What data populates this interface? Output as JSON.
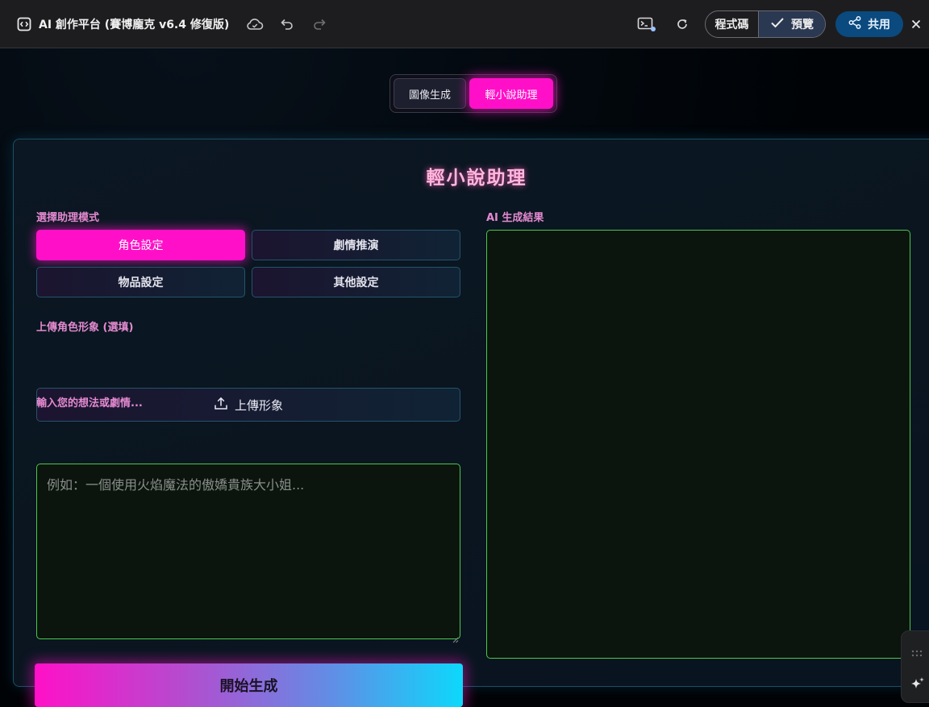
{
  "topbar": {
    "title": "AI 創作平台 (賽博龐克 v6.4 修復版)",
    "code_label": "程式碼",
    "preview_label": "預覽",
    "share_label": "共用"
  },
  "mode_switch": {
    "image_label": "圖像生成",
    "novel_label": "輕小說助理"
  },
  "panel": {
    "title": "輕小說助理",
    "assist_mode_label": "選擇助理模式",
    "assist_modes": [
      "角色設定",
      "劇情推演",
      "物品設定",
      "其他設定"
    ],
    "upload_label": "上傳角色形象 (選填)",
    "upload_button": "上傳形象",
    "idea_label": "輸入您的想法或劇情...",
    "idea_placeholder": "例如：一個使用火焰魔法的傲嬌貴族大小姐...",
    "generate_button": "開始生成",
    "result_label": "AI 生成結果"
  },
  "colors": {
    "accent_pink": "#ff10c8",
    "accent_cyan": "#0dd8fb",
    "input_border_green": "#4cc84c",
    "share_blue": "#0a4a7e"
  },
  "icons": {
    "app": "code-window-icon",
    "cloud": "cloud-sync-icon",
    "undo": "undo-icon",
    "redo": "redo-icon",
    "terminal": "terminal-icon",
    "refresh": "refresh-icon",
    "check": "check-icon",
    "share": "share-icon",
    "close": "close-icon",
    "upload": "upload-icon",
    "drag": "drag-grip-icon",
    "sparkle": "sparkle-icon"
  }
}
